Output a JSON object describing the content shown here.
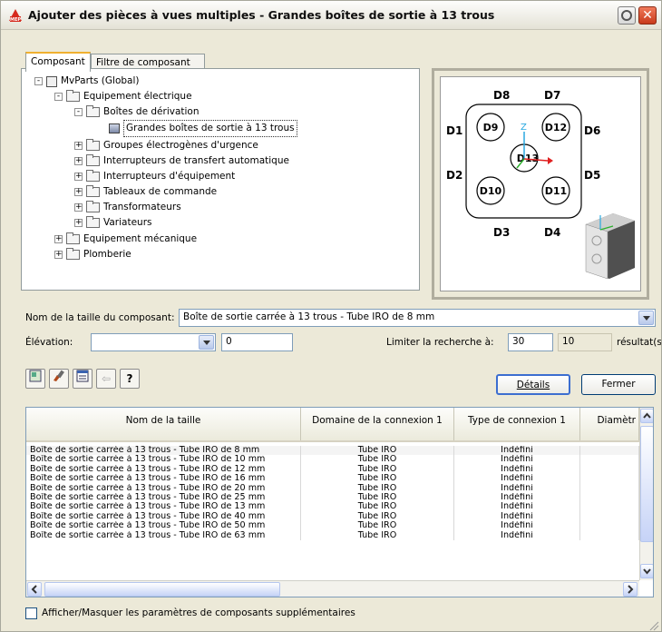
{
  "window": {
    "title": "Ajouter des pièces à vues multiples - Grandes boîtes de sortie à 13 trous",
    "icon_label": "MEP"
  },
  "tabs": [
    {
      "label": "Composant"
    },
    {
      "label": "Filtre de composant"
    }
  ],
  "tree": [
    {
      "label": "MvParts (Global)",
      "expander": "-"
    },
    {
      "label": "Equipement électrique",
      "expander": "-"
    },
    {
      "label": "Boîtes de dérivation",
      "expander": "-"
    },
    {
      "label": "Grandes boîtes de sortie à 13 trous",
      "expander": ""
    },
    {
      "label": "Groupes électrogènes d'urgence",
      "expander": "+"
    },
    {
      "label": "Interrupteurs de transfert automatique",
      "expander": "+"
    },
    {
      "label": "Interrupteurs d'équipement",
      "expander": "+"
    },
    {
      "label": "Tableaux de commande",
      "expander": "+"
    },
    {
      "label": "Transformateurs",
      "expander": "+"
    },
    {
      "label": "Variateurs",
      "expander": "+"
    },
    {
      "label": "Equipement mécanique",
      "expander": "+"
    },
    {
      "label": "Plomberie",
      "expander": "+"
    }
  ],
  "preview": {
    "labels": [
      "D8",
      "D7",
      "D1",
      "D6",
      "D2",
      "D5",
      "D3",
      "D4"
    ],
    "holes": [
      "D9",
      "D12",
      "D13",
      "D10",
      "D11"
    ],
    "axis_z": "Z"
  },
  "form": {
    "size_label": "Nom de la taille du composant:",
    "size_value": "Boîte de sortie carrée à 13 trous - Tube IRO de 8 mm",
    "elevation_label": "Élévation:",
    "elevation_value": "0",
    "limit_label": "Limiter la recherche à:",
    "limit_value": "30",
    "result_count": "10",
    "result_suffix": "résultat(s)"
  },
  "toolbar": {
    "icons": [
      "catalog-icon",
      "paint-brush-icon",
      "properties-icon",
      "undo-icon",
      "help-icon"
    ],
    "help_glyph": "?",
    "undo_glyph": "⇦"
  },
  "buttons": {
    "details": "Détails",
    "close": "Fermer"
  },
  "grid": {
    "columns": [
      "Nom de la taille",
      "Domaine de la connexion 1",
      "Type de connexion 1",
      "Diamètr"
    ],
    "rows": [
      [
        "Boîte de sortie carrée à 13 trous - Tube IRO de 8 mm",
        "Tube IRO",
        "Indéfini",
        ""
      ],
      [
        "Boîte de sortie carrée à 13 trous - Tube IRO de 10 mm",
        "Tube IRO",
        "Indéfini",
        ""
      ],
      [
        "Boîte de sortie carrée à 13 trous - Tube IRO de 12 mm",
        "Tube IRO",
        "Indéfini",
        ""
      ],
      [
        "Boîte de sortie carrée à 13 trous - Tube IRO de 16 mm",
        "Tube IRO",
        "Indéfini",
        ""
      ],
      [
        "Boîte de sortie carrée à 13 trous - Tube IRO de 20 mm",
        "Tube IRO",
        "Indéfini",
        ""
      ],
      [
        "Boîte de sortie carrée à 13 trous - Tube IRO de 25 mm",
        "Tube IRO",
        "Indéfini",
        ""
      ],
      [
        "Boîte de sortie carrée à 13 trous - Tube IRO de 13 mm",
        "Tube IRO",
        "Indéfini",
        ""
      ],
      [
        "Boîte de sortie carrée à 13 trous - Tube IRO de 40 mm",
        "Tube IRO",
        "Indéfini",
        ""
      ],
      [
        "Boîte de sortie carrée à 13 trous - Tube IRO de 50 mm",
        "Tube IRO",
        "Indéfini",
        ""
      ],
      [
        "Boîte de sortie carrée à 13 trous - Tube IRO de 63 mm",
        "Tube IRO",
        "Indéfini",
        ""
      ]
    ]
  },
  "footer": {
    "checkbox_label": "Afficher/Masquer les paramètres de composants supplémentaires"
  }
}
